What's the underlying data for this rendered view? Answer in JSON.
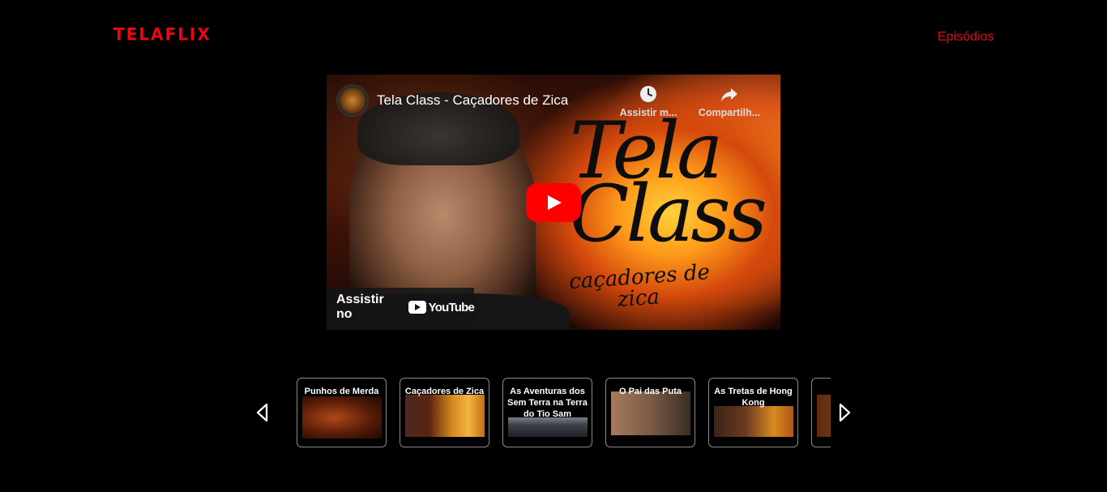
{
  "header": {
    "logo": "TELAFLIX",
    "nav_link": "Episódios"
  },
  "player": {
    "video_title": "Tela Class - Caçadores de Zica",
    "watch_later_label": "Assistir m...",
    "share_label": "Compartilh...",
    "watch_on_label": "Assistir no",
    "youtube_word": "YouTube"
  },
  "carousel": {
    "episodes": [
      {
        "title": "Punhos de Merda"
      },
      {
        "title": "Caçadores de Zica"
      },
      {
        "title": "As Aventuras dos Sem Terra na Terra do Tio Sam"
      },
      {
        "title": "O Pai das Puta"
      },
      {
        "title": "As Tretas de Hong Kong"
      },
      {
        "title": ""
      }
    ]
  },
  "colors": {
    "brand_red": "#e50914",
    "youtube_red": "#ff0000",
    "background": "#000000"
  }
}
